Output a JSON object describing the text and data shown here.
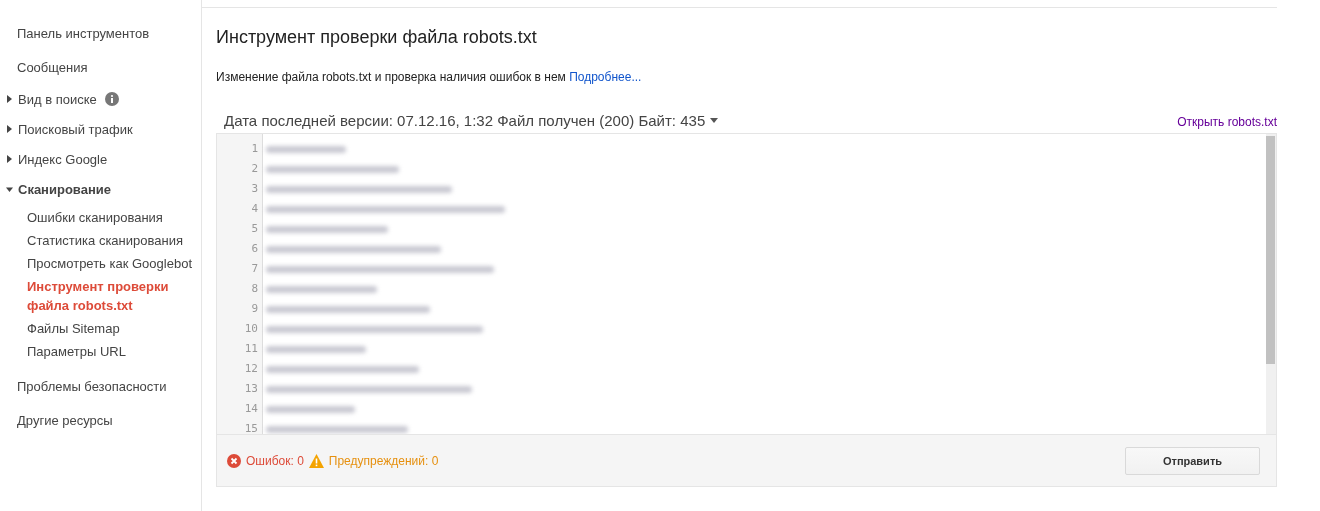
{
  "sidebar": {
    "items": [
      {
        "label": "Панель инструментов",
        "kind": "link",
        "selected": false
      },
      {
        "label": "Сообщения",
        "kind": "link",
        "selected": false
      },
      {
        "label": "Вид в поиске",
        "kind": "group",
        "expanded": false,
        "info_icon": true,
        "selected": false
      },
      {
        "label": "Поисковый трафик",
        "kind": "group",
        "expanded": false,
        "info_icon": false,
        "selected": false
      },
      {
        "label": "Индекс Google",
        "kind": "group",
        "expanded": false,
        "info_icon": false,
        "selected": false
      },
      {
        "label": "Сканирование",
        "kind": "group",
        "expanded": true,
        "info_icon": false,
        "selected": false,
        "children": [
          {
            "label": "Ошибки сканирования",
            "selected": false
          },
          {
            "label": "Статистика сканирования",
            "selected": false
          },
          {
            "label": "Просмотреть как Googlebot",
            "selected": false
          },
          {
            "label": "Инструмент проверки файла robots.txt",
            "selected": true
          },
          {
            "label": "Файлы Sitemap",
            "selected": false
          },
          {
            "label": "Параметры URL",
            "selected": false
          }
        ]
      },
      {
        "label": "Проблемы безопасности",
        "kind": "link",
        "selected": false
      },
      {
        "label": "Другие ресурсы",
        "kind": "link",
        "selected": false
      }
    ]
  },
  "page": {
    "title": "Инструмент проверки файла robots.txt",
    "description": "Изменение файла robots.txt и проверка наличия ошибок в нем",
    "more_link": "Подробнее..."
  },
  "editor": {
    "version_info": "Дата последней версии: 07.12.16, 1:32 Файл получен (200) Байт: 435",
    "open_link": "Открыть robots.txt",
    "lines": [
      {
        "number": "1"
      },
      {
        "number": "2"
      },
      {
        "number": "3"
      },
      {
        "number": "4"
      },
      {
        "number": "5"
      },
      {
        "number": "6"
      },
      {
        "number": "7"
      },
      {
        "number": "8"
      },
      {
        "number": "9"
      },
      {
        "number": "10"
      },
      {
        "number": "11"
      },
      {
        "number": "12"
      },
      {
        "number": "13"
      },
      {
        "number": "14"
      },
      {
        "number": "15"
      }
    ],
    "errors": "Ошибок: 0",
    "warnings": "Предупреждений: 0",
    "submit": "Отправить"
  }
}
